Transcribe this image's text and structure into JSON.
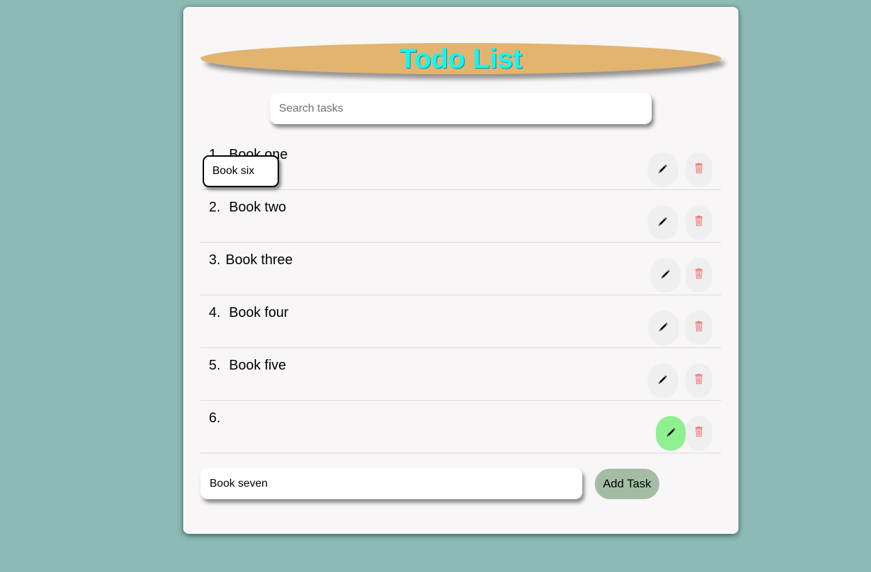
{
  "header": {
    "title": "Todo List"
  },
  "search": {
    "placeholder": "Search tasks",
    "value": ""
  },
  "tasks": [
    {
      "number": "1.",
      "label": "Book one",
      "editing": false
    },
    {
      "number": "2.",
      "label": "Book two",
      "editing": false
    },
    {
      "number": "3.",
      "label": "Book three",
      "editing": false
    },
    {
      "number": "4.",
      "label": "Book four",
      "editing": false
    },
    {
      "number": "5.",
      "label": "Book five",
      "editing": false
    },
    {
      "number": "6.",
      "label": "Book six",
      "editing": true
    }
  ],
  "add": {
    "input_value": "Book seven",
    "button_label": "Add Task"
  },
  "icons": {
    "edit": "pencil-icon",
    "delete": "trash-icon"
  },
  "colors": {
    "background": "#8cbab4",
    "title_text": "#16f4f4",
    "title_banner": "#e2b470",
    "edit_active": "#90f090",
    "delete_icon": "#f08080",
    "add_button": "#a4bca4"
  }
}
